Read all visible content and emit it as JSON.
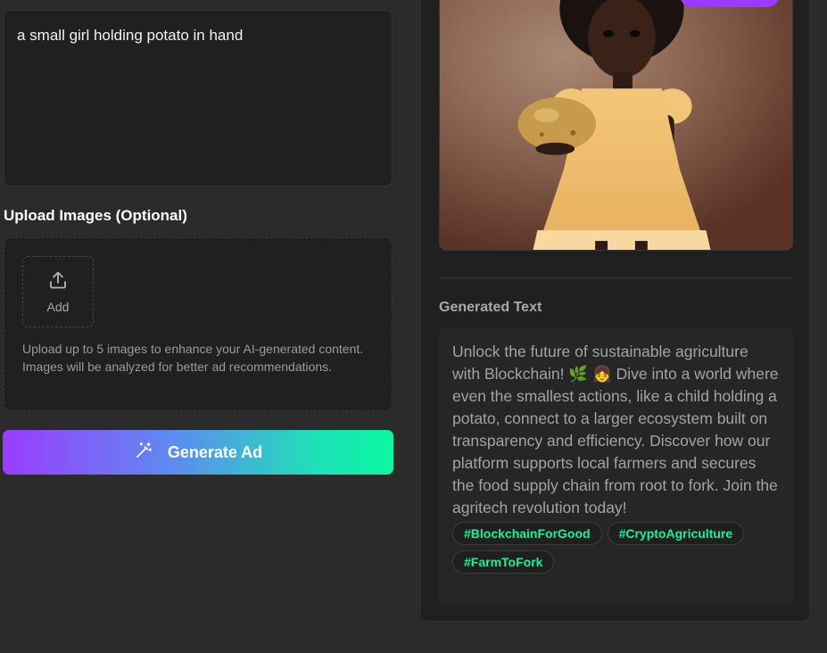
{
  "prompt": {
    "text": "a small girl holding potato in hand"
  },
  "upload": {
    "heading": "Upload Images (Optional)",
    "add_label": "Add",
    "help_text": "Upload up to 5 images to enhance your AI-generated content. Images will be analyzed for better ad recommendations."
  },
  "generate_button": {
    "label": "Generate Ad"
  },
  "output": {
    "generated_text_heading": "Generated Text",
    "generated_text": "Unlock the future of sustainable agriculture with Blockchain! 🌿 👧 Dive into a world where even the smallest actions, like a child holding a potato, connect to a larger ecosystem built on transparency and efficiency. Discover how our platform supports local farmers and secures the food supply chain from root to fork. Join the agritech revolution today!",
    "hashtags": [
      "#BlockchainForGood",
      "#CryptoAgriculture",
      "#FarmToFork"
    ]
  },
  "colors": {
    "accent_purple": "#9a3cff",
    "accent_green": "#0af7a3",
    "hashtag": "#19f0a0"
  },
  "icons": {
    "upload": "upload-icon",
    "generate": "magic-wand-icon"
  }
}
